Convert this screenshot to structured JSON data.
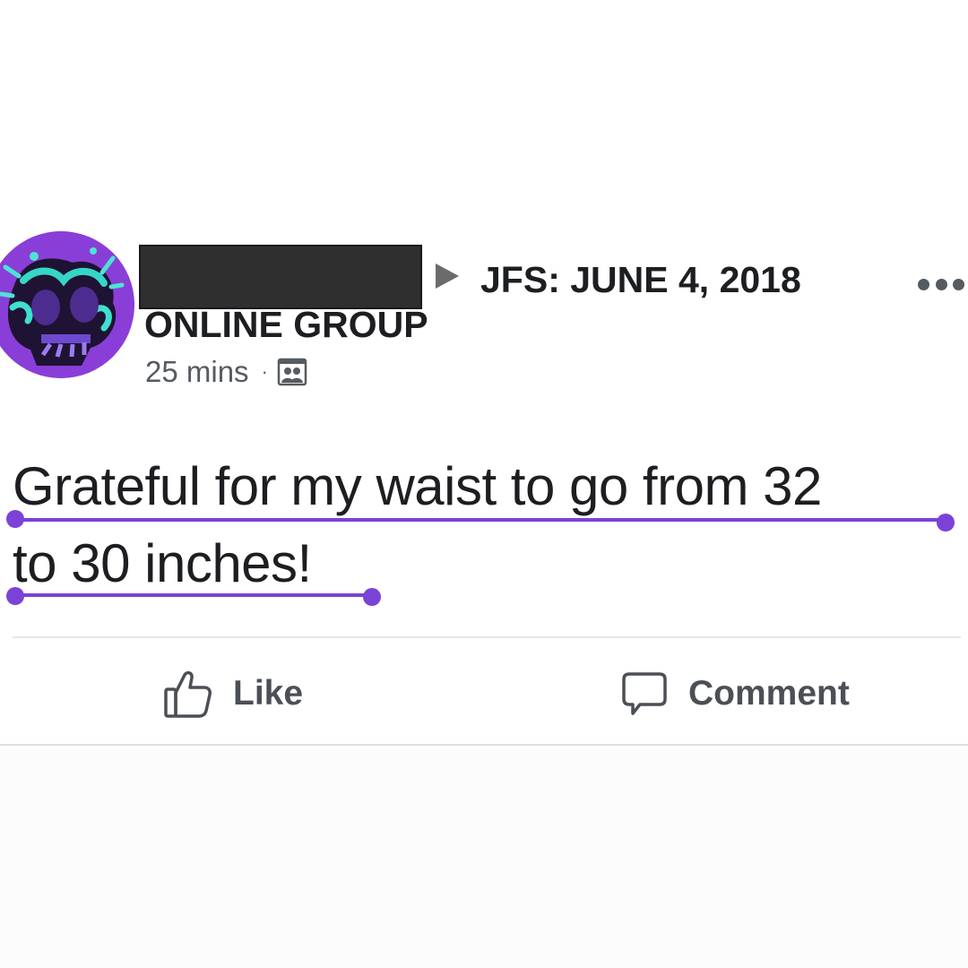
{
  "post": {
    "author_avatar_icon": "skull-avatar-icon",
    "author_name_redacted": true,
    "group_name": "JFS: JUNE 4, 2018",
    "subgroup_label": "ONLINE GROUP",
    "timestamp": "25 mins",
    "separator": "·",
    "audience_icon": "group-audience-icon",
    "more_icon": "more-options-icon",
    "text_line_1": "Grateful for my waist to go from 32",
    "text_line_2": "to 30 inches!"
  },
  "actions": {
    "like_label": "Like",
    "like_icon": "thumbs-up-icon",
    "comment_label": "Comment",
    "comment_icon": "speech-bubble-icon"
  },
  "colors": {
    "highlight": "#7b42d8",
    "avatar_bg": "#8a3ed8",
    "text": "#1c1e21",
    "muted": "#555b61"
  }
}
